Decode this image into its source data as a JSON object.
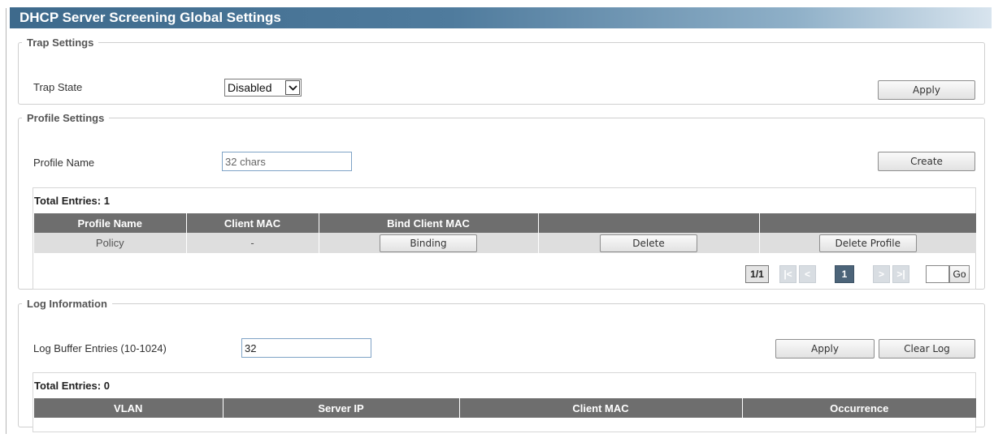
{
  "page": {
    "title": "DHCP Server Screening Global Settings"
  },
  "trap": {
    "legend": "Trap Settings",
    "state_label": "Trap State",
    "state_value": "Disabled",
    "apply_label": "Apply"
  },
  "profile": {
    "legend": "Profile Settings",
    "name_label": "Profile Name",
    "name_placeholder": "32 chars",
    "create_label": "Create",
    "total_entries": "Total Entries: 1",
    "columns": [
      "Profile Name",
      "Client MAC",
      "Bind Client MAC",
      "",
      ""
    ],
    "rows": [
      {
        "profile_name": "Policy",
        "client_mac": "-",
        "binding_label": "Binding",
        "delete_label": "Delete",
        "delete_profile_label": "Delete Profile"
      }
    ],
    "pagination": {
      "count": "1/1",
      "first": "|<",
      "prev": "<",
      "current": "1",
      "next": ">",
      "last": ">|",
      "go_label": "Go"
    }
  },
  "log": {
    "legend": "Log Information",
    "buffer_label": "Log Buffer Entries (10-1024)",
    "buffer_value": "32",
    "apply_label": "Apply",
    "clear_label": "Clear Log",
    "total_entries": "Total Entries: 0",
    "columns": [
      "VLAN",
      "Server IP",
      "Client MAC",
      "Occurrence"
    ]
  },
  "colors": {
    "title_bar": "#4f7b9d",
    "table_header": "#6e6e6e",
    "row_bg": "#dedede",
    "page_current": "#4c6479"
  }
}
